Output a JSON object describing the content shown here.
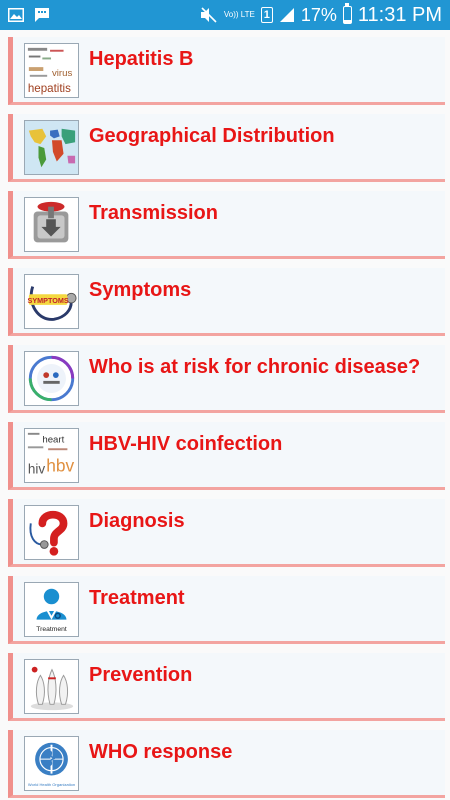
{
  "status_bar": {
    "network": "Vo)) LTE",
    "sim_slot": "1",
    "battery_percent": "17%",
    "battery_level": 0.17,
    "time": "11:31 PM",
    "left_icons": [
      "gallery-icon",
      "message-icon"
    ]
  },
  "topics": [
    {
      "label": "Hepatitis B",
      "icon": "hepatitis-word-cloud-icon"
    },
    {
      "label": "Geographical Distribution",
      "icon": "world-map-icon"
    },
    {
      "label": "Transmission",
      "icon": "transmission-icon"
    },
    {
      "label": "Symptoms",
      "icon": "stethoscope-symptoms-icon"
    },
    {
      "label": "Who is at risk for chronic disease?",
      "icon": "risk-circle-icon"
    },
    {
      "label": "HBV-HIV coinfection",
      "icon": "hbv-hiv-word-cloud-icon"
    },
    {
      "label": "Diagnosis",
      "icon": "question-stethoscope-icon"
    },
    {
      "label": "Treatment",
      "icon": "doctor-icon"
    },
    {
      "label": "Prevention",
      "icon": "bowling-pins-icon"
    },
    {
      "label": "WHO response",
      "icon": "who-logo-icon"
    }
  ],
  "thumbnail_text": {
    "hepatitis": [
      "virus",
      "hepatitis"
    ],
    "symptoms": "SYMPTOMS",
    "hbv_hiv": [
      "heart",
      "hiv",
      "hbv"
    ],
    "treatment": "Treatment",
    "who": "World Health Organization"
  }
}
